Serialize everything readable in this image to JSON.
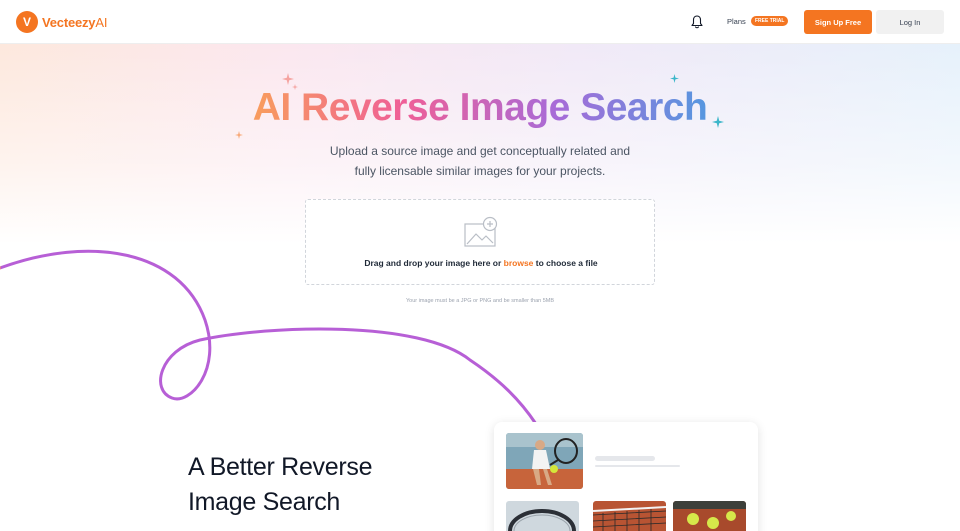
{
  "header": {
    "logo_mark": "V",
    "logo_name": "Vecteezy",
    "logo_ai": "AI",
    "plans_label": "Plans",
    "trial_badge": "FREE TRIAL",
    "signup_label": "Sign Up Free",
    "login_label": "Log In",
    "brand_color": "#f47521"
  },
  "hero": {
    "title": "AI Reverse Image Search",
    "subtitle_line1": "Upload a source image and get conceptually related and",
    "subtitle_line2": "fully licensable similar images for your projects."
  },
  "dropzone": {
    "text_before": "Drag and drop your image here or ",
    "browse_label": "browse",
    "text_after": " to choose a file",
    "hint": "Your image must be a JPG or PNG and be smaller than 5MB"
  },
  "section": {
    "title_line1": "A Better Reverse",
    "title_line2": "Image Search"
  },
  "icons": {
    "bell": "bell-icon",
    "upload": "image-upload-icon",
    "sparkle": "sparkle-icon"
  }
}
